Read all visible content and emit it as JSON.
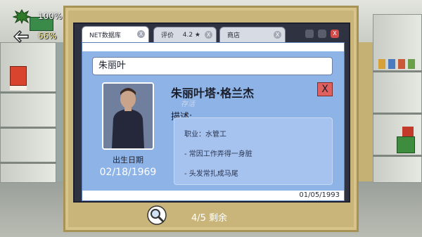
{
  "hud": {
    "health_percent": "100%",
    "stamina_percent": "66%"
  },
  "browser": {
    "tabs": [
      {
        "label": "NET数据库",
        "close": "X"
      },
      {
        "label": "评价",
        "rating": "4.2 ★",
        "close": "X"
      },
      {
        "label": "商店",
        "close": "X"
      }
    ],
    "window_close": "X"
  },
  "record": {
    "search_value": "朱丽叶",
    "name": "朱丽叶塔·格兰杰",
    "status": "存活",
    "close_label": "X",
    "dob_label": "出生日期",
    "dob_value": "02/18/1969",
    "description_label": "描述:",
    "description_items": [
      "职业：水管工",
      "- 常因工作弄得一身脏",
      "- 头发常扎成马尾"
    ],
    "footer_date": "01/05/1993"
  },
  "footer": {
    "remaining": "4/5 剩余"
  },
  "icons": {
    "health": "splat-icon",
    "stamina": "hand-pointer-icon",
    "search": "magnifier-icon"
  }
}
